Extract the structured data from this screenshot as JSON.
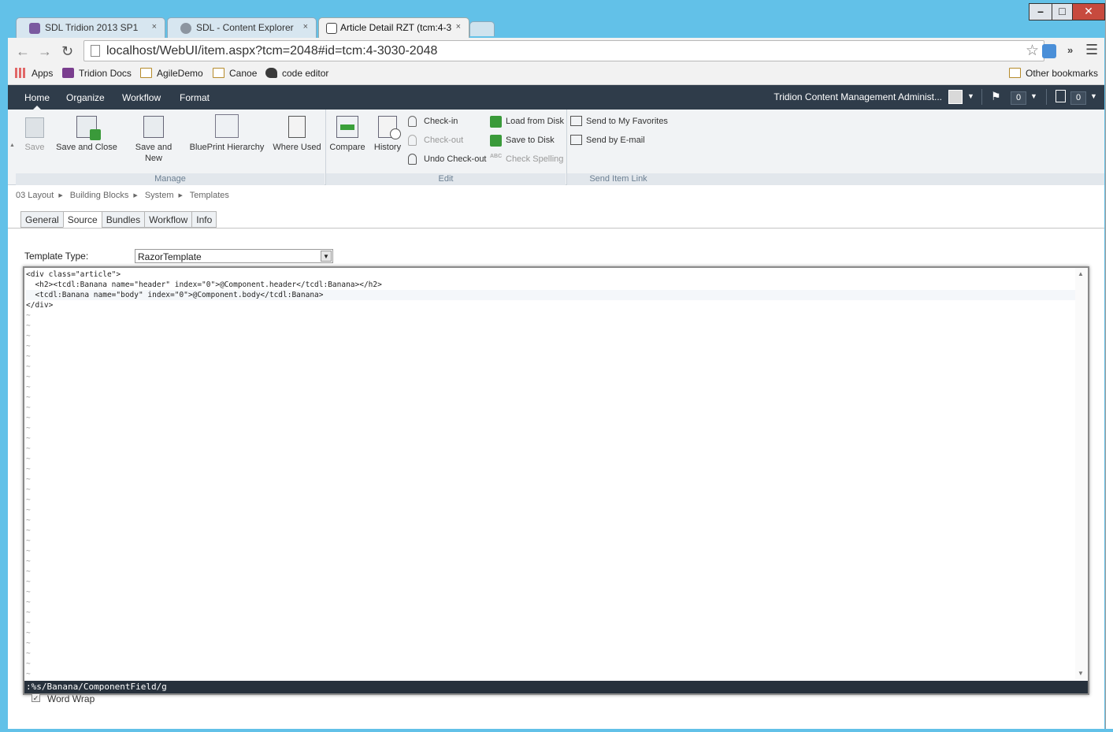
{
  "browser": {
    "tabs": [
      {
        "title": "SDL Tridion 2013 SP1",
        "active": false
      },
      {
        "title": "SDL - Content Explorer",
        "active": false
      },
      {
        "title": "Article Detail RZT (tcm:4-3",
        "active": true
      }
    ],
    "close_glyph": "×",
    "url": "localhost/WebUI/item.aspx?tcm=2048#id=tcm:4-3030-2048",
    "bookmarks": [
      {
        "label": "Apps",
        "icon": "apps-grid-icon"
      },
      {
        "label": "Tridion Docs",
        "icon": "tridion-icon"
      },
      {
        "label": "AgileDemo",
        "icon": "folder-icon"
      },
      {
        "label": "Canoe",
        "icon": "folder-icon"
      },
      {
        "label": "code editor",
        "icon": "code-editor-icon"
      }
    ],
    "other_bookmarks": "Other bookmarks"
  },
  "topnav": {
    "items": [
      "Home",
      "Organize",
      "Workflow",
      "Format"
    ],
    "user": "Tridion Content Management Administ...",
    "flag_count": "0",
    "notes_count": "0"
  },
  "ribbon": {
    "manage": {
      "label": "Manage",
      "save": "Save",
      "save_close": "Save and Close",
      "save_new_1": "Save and",
      "save_new_2": "New",
      "blueprint": "BluePrint Hierarchy",
      "where_used": "Where Used"
    },
    "edit": {
      "label": "Edit",
      "compare": "Compare",
      "history": "History",
      "checkin": "Check-in",
      "checkout": "Check-out",
      "undo_checkout": "Undo Check-out",
      "load_disk": "Load from Disk",
      "save_disk": "Save to Disk",
      "check_spelling": "Check Spelling"
    },
    "send": {
      "label": "Send Item Link",
      "favorites": "Send to My Favorites",
      "email": "Send by E-mail"
    }
  },
  "breadcrumb": [
    "03 Layout",
    "Building Blocks",
    "System",
    "Templates"
  ],
  "content_tabs": [
    {
      "label": "General",
      "active": false
    },
    {
      "label": "Source",
      "active": true
    },
    {
      "label": "Bundles",
      "active": false
    },
    {
      "label": "Workflow",
      "active": false
    },
    {
      "label": "Info",
      "active": false
    }
  ],
  "template_type": {
    "label": "Template Type:",
    "value": "RazorTemplate"
  },
  "editor": {
    "lines": [
      "<div class=\"article\">",
      "  <h2><tcdl:Banana name=\"header\" index=\"0\">@Component.header</tcdl:Banana></h2>",
      "  <tcdl:Banana name=\"body\" index=\"0\">@Component.body</tcdl:Banana>",
      "</div>"
    ],
    "tilde": "~",
    "command": ":%s/Banana/ComponentField/g"
  },
  "word_wrap": {
    "label": "Word Wrap",
    "checked": true
  }
}
